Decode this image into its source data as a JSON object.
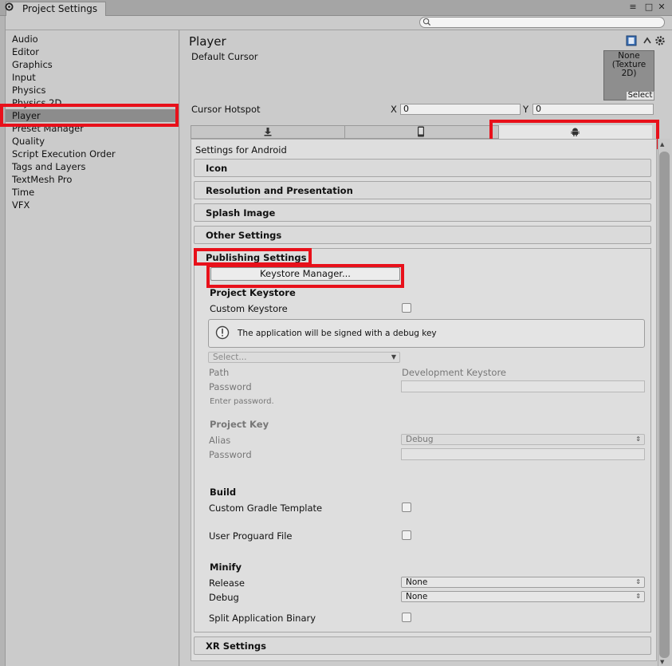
{
  "window": {
    "tab_title": "Project Settings",
    "controls": {
      "menu": "≡",
      "maximize": "□",
      "close": "✕"
    }
  },
  "search": {
    "placeholder": ""
  },
  "sidebar": {
    "items": [
      {
        "label": "Audio"
      },
      {
        "label": "Editor"
      },
      {
        "label": "Graphics"
      },
      {
        "label": "Input"
      },
      {
        "label": "Physics"
      },
      {
        "label": "Physics 2D"
      },
      {
        "label": "Player",
        "selected": true
      },
      {
        "label": "Preset Manager"
      },
      {
        "label": "Quality"
      },
      {
        "label": "Script Execution Order"
      },
      {
        "label": "Tags and Layers"
      },
      {
        "label": "TextMesh Pro"
      },
      {
        "label": "Time"
      },
      {
        "label": "VFX"
      }
    ]
  },
  "player": {
    "title": "Player",
    "header_icons": [
      "book-icon",
      "presets-icon",
      "gear-icon"
    ],
    "default_cursor_label": "Default Cursor",
    "texture_text": "None\n(Texture\n2D)",
    "texture_select": "Select",
    "cursor_hotspot_label": "Cursor Hotspot",
    "hotspot": {
      "x_label": "X",
      "x_value": "0",
      "y_label": "Y",
      "y_value": "0"
    },
    "platform_tabs": [
      {
        "icon": "download-icon",
        "selected": false
      },
      {
        "icon": "phone-icon",
        "selected": false
      },
      {
        "icon": "android-icon",
        "selected": true
      }
    ],
    "settings_for": "Settings for Android",
    "sections": {
      "icon": "Icon",
      "resolution": "Resolution and Presentation",
      "splash": "Splash Image",
      "other": "Other Settings",
      "publishing": "Publishing Settings",
      "xr": "XR Settings"
    }
  },
  "publishing": {
    "keystore_manager_button": "Keystore Manager...",
    "project_keystore_heading": "Project Keystore",
    "custom_keystore_label": "Custom Keystore",
    "custom_keystore_checked": false,
    "info_message": "The application will be signed with a debug key",
    "keystore_select_value": "Select...",
    "path_label": "Path",
    "path_value": "Development Keystore",
    "password_label": "Password",
    "password_hint": "Enter password.",
    "project_key_heading": "Project Key",
    "alias_label": "Alias",
    "alias_value": "Debug",
    "key_password_label": "Password",
    "build_heading": "Build",
    "custom_gradle_label": "Custom Gradle Template",
    "custom_gradle_checked": false,
    "user_proguard_label": "User Proguard File",
    "user_proguard_checked": false,
    "minify_heading": "Minify",
    "release_label": "Release",
    "release_value": "None",
    "debug_label": "Debug",
    "debug_value": "None",
    "split_binary_label": "Split Application Binary",
    "split_binary_checked": false
  },
  "colors": {
    "highlight": "#e8101a",
    "selected_row": "#8c8c8c",
    "panel": "#dedede"
  }
}
